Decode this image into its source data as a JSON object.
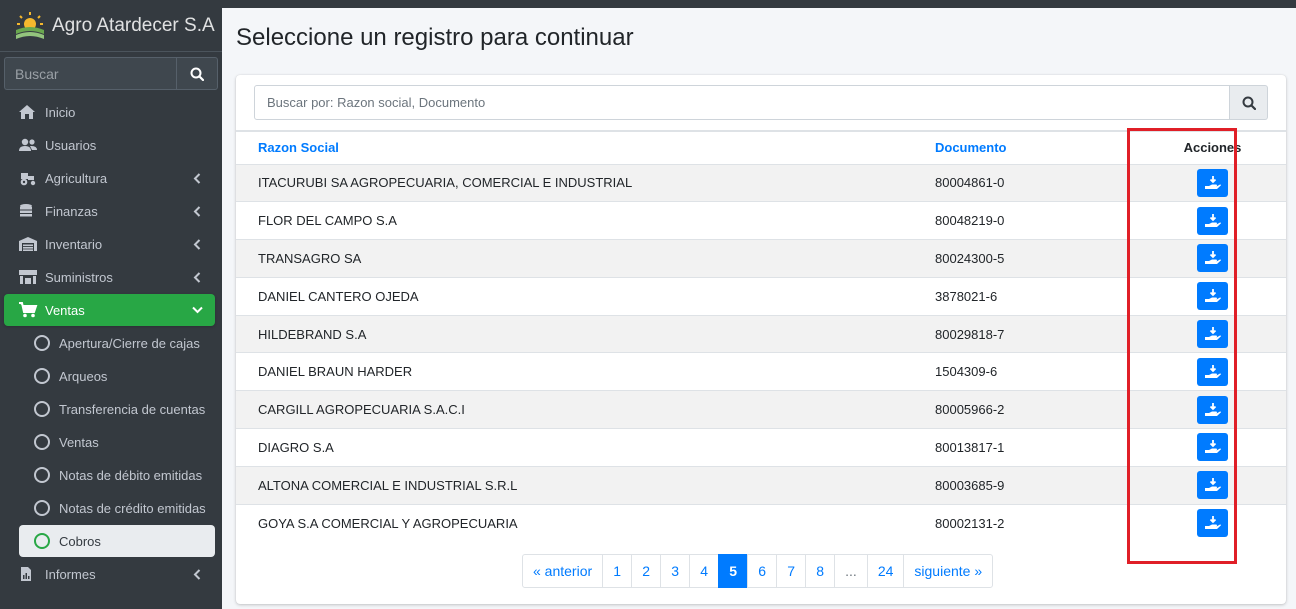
{
  "brand": {
    "name": "Agro Atardecer S.A"
  },
  "sidebar": {
    "search_placeholder": "Buscar",
    "items": [
      {
        "label": "Inicio",
        "icon": "home-icon",
        "expandable": false
      },
      {
        "label": "Usuarios",
        "icon": "users-icon",
        "expandable": false
      },
      {
        "label": "Agricultura",
        "icon": "tractor-icon",
        "expandable": true
      },
      {
        "label": "Finanzas",
        "icon": "coins-icon",
        "expandable": true
      },
      {
        "label": "Inventario",
        "icon": "warehouse-icon",
        "expandable": true
      },
      {
        "label": "Suministros",
        "icon": "store-icon",
        "expandable": true
      },
      {
        "label": "Ventas",
        "icon": "cart-icon",
        "expandable": true,
        "active": true
      }
    ],
    "ventas_sub": [
      {
        "label": "Apertura/Cierre de cajas"
      },
      {
        "label": "Arqueos"
      },
      {
        "label": "Transferencia de cuentas"
      },
      {
        "label": "Ventas"
      },
      {
        "label": "Notas de débito emitidas"
      },
      {
        "label": "Notas de crédito emitidas"
      },
      {
        "label": "Cobros",
        "current": true
      }
    ],
    "after_items": [
      {
        "label": "Informes",
        "icon": "report-icon",
        "expandable": true
      }
    ]
  },
  "main": {
    "title": "Seleccione un registro para continuar",
    "search_placeholder": "Buscar por: Razon social, Documento",
    "table": {
      "headers": {
        "name": "Razon Social",
        "doc": "Documento",
        "actions": "Acciones"
      },
      "rows": [
        {
          "name": "ITACURUBI SA AGROPECUARIA, COMERCIAL E INDUSTRIAL",
          "doc": "80004861-0"
        },
        {
          "name": "FLOR DEL CAMPO S.A",
          "doc": "80048219-0"
        },
        {
          "name": "TRANSAGRO SA",
          "doc": "80024300-5"
        },
        {
          "name": "DANIEL CANTERO OJEDA",
          "doc": "3878021-6"
        },
        {
          "name": "HILDEBRAND S.A",
          "doc": "80029818-7"
        },
        {
          "name": "DANIEL BRAUN HARDER",
          "doc": "1504309-6"
        },
        {
          "name": "CARGILL AGROPECUARIA S.A.C.I",
          "doc": "80005966-2"
        },
        {
          "name": "DIAGRO S.A",
          "doc": "80013817-1"
        },
        {
          "name": "ALTONA COMERCIAL E INDUSTRIAL S.R.L",
          "doc": "80003685-9"
        },
        {
          "name": "GOYA S.A COMERCIAL Y AGROPECUARIA",
          "doc": "80002131-2"
        }
      ]
    },
    "pagination": {
      "prev": "« anterior",
      "pages": [
        "1",
        "2",
        "3",
        "4",
        "5",
        "6",
        "7",
        "8",
        "...",
        "24"
      ],
      "active": "5",
      "next": "siguiente »"
    }
  },
  "colors": {
    "accent": "#007bff",
    "active_nav": "#28a745",
    "sidebar_bg": "#343a40",
    "highlight": "#e01f27"
  }
}
